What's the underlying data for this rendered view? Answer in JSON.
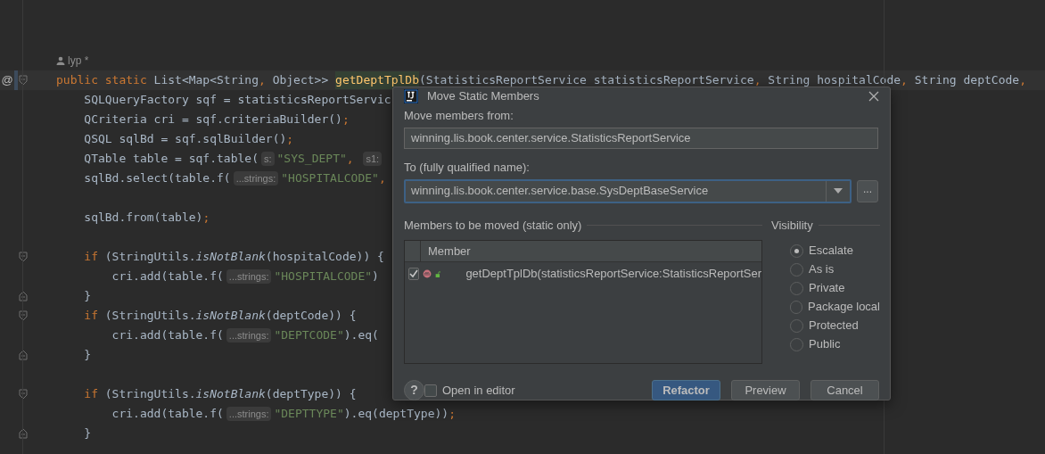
{
  "editor": {
    "lines": [
      {
        "kind": "blank"
      },
      {
        "kind": "blank"
      },
      {
        "kind": "author",
        "text": "lyp *"
      },
      {
        "kind": "current",
        "fold": {
          "kind": "open"
        },
        "marker": "@",
        "segments": [
          {
            "kind": "keyword",
            "text": "public static "
          },
          {
            "kind": "text",
            "text": "List<Map<String"
          },
          {
            "kind": "keyword",
            "text": ", "
          },
          {
            "kind": "text",
            "text": "Object>> "
          },
          {
            "kind": "method",
            "text": "getDeptTplDb"
          },
          {
            "kind": "text",
            "text": "(StatisticsReportService statisticsReportService"
          },
          {
            "kind": "keyword",
            "text": ", "
          },
          {
            "kind": "text",
            "text": "String hospitalCode"
          },
          {
            "kind": "keyword",
            "text": ", "
          },
          {
            "kind": "text",
            "text": "String deptCode"
          },
          {
            "kind": "keyword",
            "text": ","
          }
        ]
      },
      {
        "kind": "code",
        "segments": [
          {
            "kind": "text",
            "text": "    SQLQueryFactory sqf = statisticsReportServic"
          }
        ]
      },
      {
        "kind": "code",
        "segments": [
          {
            "kind": "text",
            "text": "    QCriteria cri = sqf.criteriaBuilder()"
          },
          {
            "kind": "keyword",
            "text": ";"
          }
        ]
      },
      {
        "kind": "code",
        "segments": [
          {
            "kind": "text",
            "text": "    QSQL sqlBd = sqf.sqlBuilder()"
          },
          {
            "kind": "keyword",
            "text": ";"
          }
        ]
      },
      {
        "kind": "code",
        "segments": [
          {
            "kind": "text",
            "text": "    QTable table = sqf.table("
          },
          {
            "kind": "hint",
            "text": "s:"
          },
          {
            "kind": "string",
            "text": "\"SYS_DEPT\""
          },
          {
            "kind": "keyword",
            "text": ", "
          },
          {
            "kind": "hint",
            "text": "s1:"
          }
        ]
      },
      {
        "kind": "code",
        "segments": [
          {
            "kind": "text",
            "text": "    sqlBd.select(table.f("
          },
          {
            "kind": "hint",
            "text": "...strings:"
          },
          {
            "kind": "string",
            "text": "\"HOSPITALCODE\""
          },
          {
            "kind": "keyword",
            "text": ","
          }
        ]
      },
      {
        "kind": "blank"
      },
      {
        "kind": "code",
        "segments": [
          {
            "kind": "text",
            "text": "    sqlBd.from(table)"
          },
          {
            "kind": "keyword",
            "text": ";"
          }
        ]
      },
      {
        "kind": "blank"
      },
      {
        "kind": "code",
        "fold": {
          "kind": "open"
        },
        "segments": [
          {
            "kind": "keyword",
            "text": "    if "
          },
          {
            "kind": "text",
            "text": "(StringUtils."
          },
          {
            "kind": "italic",
            "text": "isNotBlank"
          },
          {
            "kind": "text",
            "text": "(hospitalCode)) {"
          }
        ]
      },
      {
        "kind": "code",
        "segments": [
          {
            "kind": "text",
            "text": "        cri.add(table.f("
          },
          {
            "kind": "hint",
            "text": "...strings:"
          },
          {
            "kind": "string",
            "text": "\"HOSPITALCODE\""
          },
          {
            "kind": "text",
            "text": ")"
          }
        ]
      },
      {
        "kind": "code",
        "fold": {
          "kind": "close"
        },
        "segments": [
          {
            "kind": "text",
            "text": "    }"
          }
        ]
      },
      {
        "kind": "code",
        "fold": {
          "kind": "open"
        },
        "segments": [
          {
            "kind": "keyword",
            "text": "    if "
          },
          {
            "kind": "text",
            "text": "(StringUtils."
          },
          {
            "kind": "italic",
            "text": "isNotBlank"
          },
          {
            "kind": "text",
            "text": "(deptCode)) {"
          }
        ]
      },
      {
        "kind": "code",
        "segments": [
          {
            "kind": "text",
            "text": "        cri.add(table.f("
          },
          {
            "kind": "hint",
            "text": "...strings:"
          },
          {
            "kind": "string",
            "text": "\"DEPTCODE\""
          },
          {
            "kind": "text",
            "text": ").eq("
          }
        ]
      },
      {
        "kind": "code",
        "fold": {
          "kind": "close"
        },
        "segments": [
          {
            "kind": "text",
            "text": "    }"
          }
        ]
      },
      {
        "kind": "blank"
      },
      {
        "kind": "code",
        "fold": {
          "kind": "open"
        },
        "segments": [
          {
            "kind": "keyword",
            "text": "    if "
          },
          {
            "kind": "text",
            "text": "(StringUtils."
          },
          {
            "kind": "italic",
            "text": "isNotBlank"
          },
          {
            "kind": "text",
            "text": "(deptType)) {"
          }
        ]
      },
      {
        "kind": "code",
        "segments": [
          {
            "kind": "text",
            "text": "        cri.add(table.f("
          },
          {
            "kind": "hint",
            "text": "...strings:"
          },
          {
            "kind": "string",
            "text": "\"DEPTTYPE\""
          },
          {
            "kind": "text",
            "text": ").eq(deptType))"
          },
          {
            "kind": "keyword",
            "text": ";"
          }
        ]
      },
      {
        "kind": "code",
        "fold": {
          "kind": "close"
        },
        "segments": [
          {
            "kind": "text",
            "text": "    }"
          }
        ]
      }
    ]
  },
  "dialog": {
    "title": "Move Static Members",
    "from_label": "Move members from:",
    "from_value": "winning.lis.book.center.service.StatisticsReportService",
    "to_label": "To (fully qualified name):",
    "to_value": "winning.lis.book.center.service.base.SysDeptBaseService",
    "browse_button": "...",
    "members_heading": "Members to be moved (static only)",
    "member_column": "Member",
    "members": [
      {
        "checked": true,
        "text": "getDeptTplDb(statisticsReportService:StatisticsReportSer"
      }
    ],
    "visibility_heading": "Visibility",
    "visibility": [
      {
        "label": "Escalate",
        "selected": true
      },
      {
        "label": "As is",
        "selected": false
      },
      {
        "label": "Private",
        "selected": false
      },
      {
        "label": "Package local",
        "selected": false
      },
      {
        "label": "Protected",
        "selected": false
      },
      {
        "label": "Public",
        "selected": false
      }
    ],
    "help": "?",
    "open_in_editor": {
      "label": "Open in editor",
      "checked": false
    },
    "buttons": [
      {
        "label": "Refactor",
        "default": true
      },
      {
        "label": "Preview",
        "default": false
      },
      {
        "label": "Cancel",
        "default": false
      }
    ]
  }
}
